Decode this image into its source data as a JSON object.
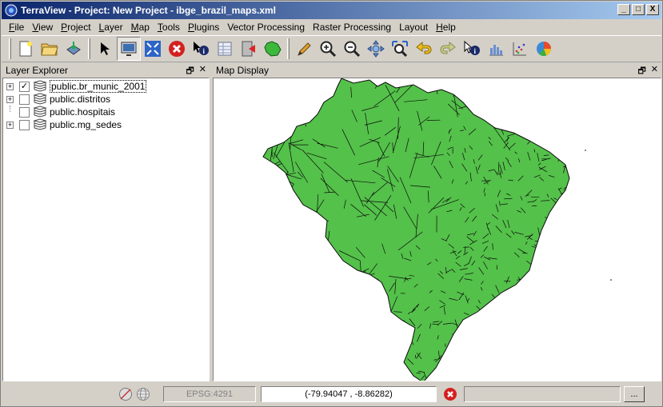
{
  "window": {
    "title": "TerraView - Project: New Project - ibge_brazil_maps.xml",
    "min_label": "_",
    "max_label": "□",
    "close_label": "X"
  },
  "menubar": {
    "items": [
      {
        "ul": "F",
        "rest": "ile"
      },
      {
        "ul": "V",
        "rest": "iew"
      },
      {
        "ul": "P",
        "rest": "roject"
      },
      {
        "ul": "L",
        "rest": "ayer"
      },
      {
        "ul": "M",
        "rest": "ap"
      },
      {
        "ul": "T",
        "rest": "ools"
      },
      {
        "ul": "P",
        "rest": "lugins"
      },
      {
        "ul": "",
        "rest": "Vector Processing"
      },
      {
        "ul": "",
        "rest": "Raster Processing"
      },
      {
        "ul": "",
        "rest": "Layout"
      },
      {
        "ul": "H",
        "rest": "elp"
      }
    ]
  },
  "toolbar": {
    "icons": [
      "new-project-icon",
      "open-project-icon",
      "save-project-icon",
      "select-pointer-icon",
      "selection-monitor-icon",
      "zoom-extent-icon",
      "stop-draw-icon",
      "info-cursor-icon",
      "data-table-icon",
      "drawing-toggle-icon",
      "map-area-icon",
      "pencil-icon",
      "zoom-in-icon",
      "zoom-out-icon",
      "pan-icon",
      "zoom-area-icon",
      "previous-extent-icon",
      "next-extent-icon",
      "info-icon",
      "histogram-icon",
      "scatter-icon",
      "pie-chart-icon"
    ]
  },
  "layer_explorer": {
    "title": "Layer Explorer",
    "float_label": "🗗",
    "close_label": "✕",
    "layers": [
      {
        "name": "public.br_munic_2001",
        "checked": true,
        "expandable": true,
        "selected": true
      },
      {
        "name": "public.distritos",
        "checked": false,
        "expandable": true,
        "selected": false
      },
      {
        "name": "public.hospitais",
        "checked": false,
        "expandable": false,
        "selected": false
      },
      {
        "name": "public.mg_sedes",
        "checked": false,
        "expandable": true,
        "selected": false
      }
    ]
  },
  "map_display": {
    "title": "Map Display",
    "float_label": "🗗",
    "close_label": "✕",
    "fill_color": "#54c14a",
    "stroke_color": "#0a0a0a"
  },
  "statusbar": {
    "srs": "EPSG:4291",
    "coordinates": "(-79.94047 , -8.86282)",
    "more_label": "..."
  }
}
